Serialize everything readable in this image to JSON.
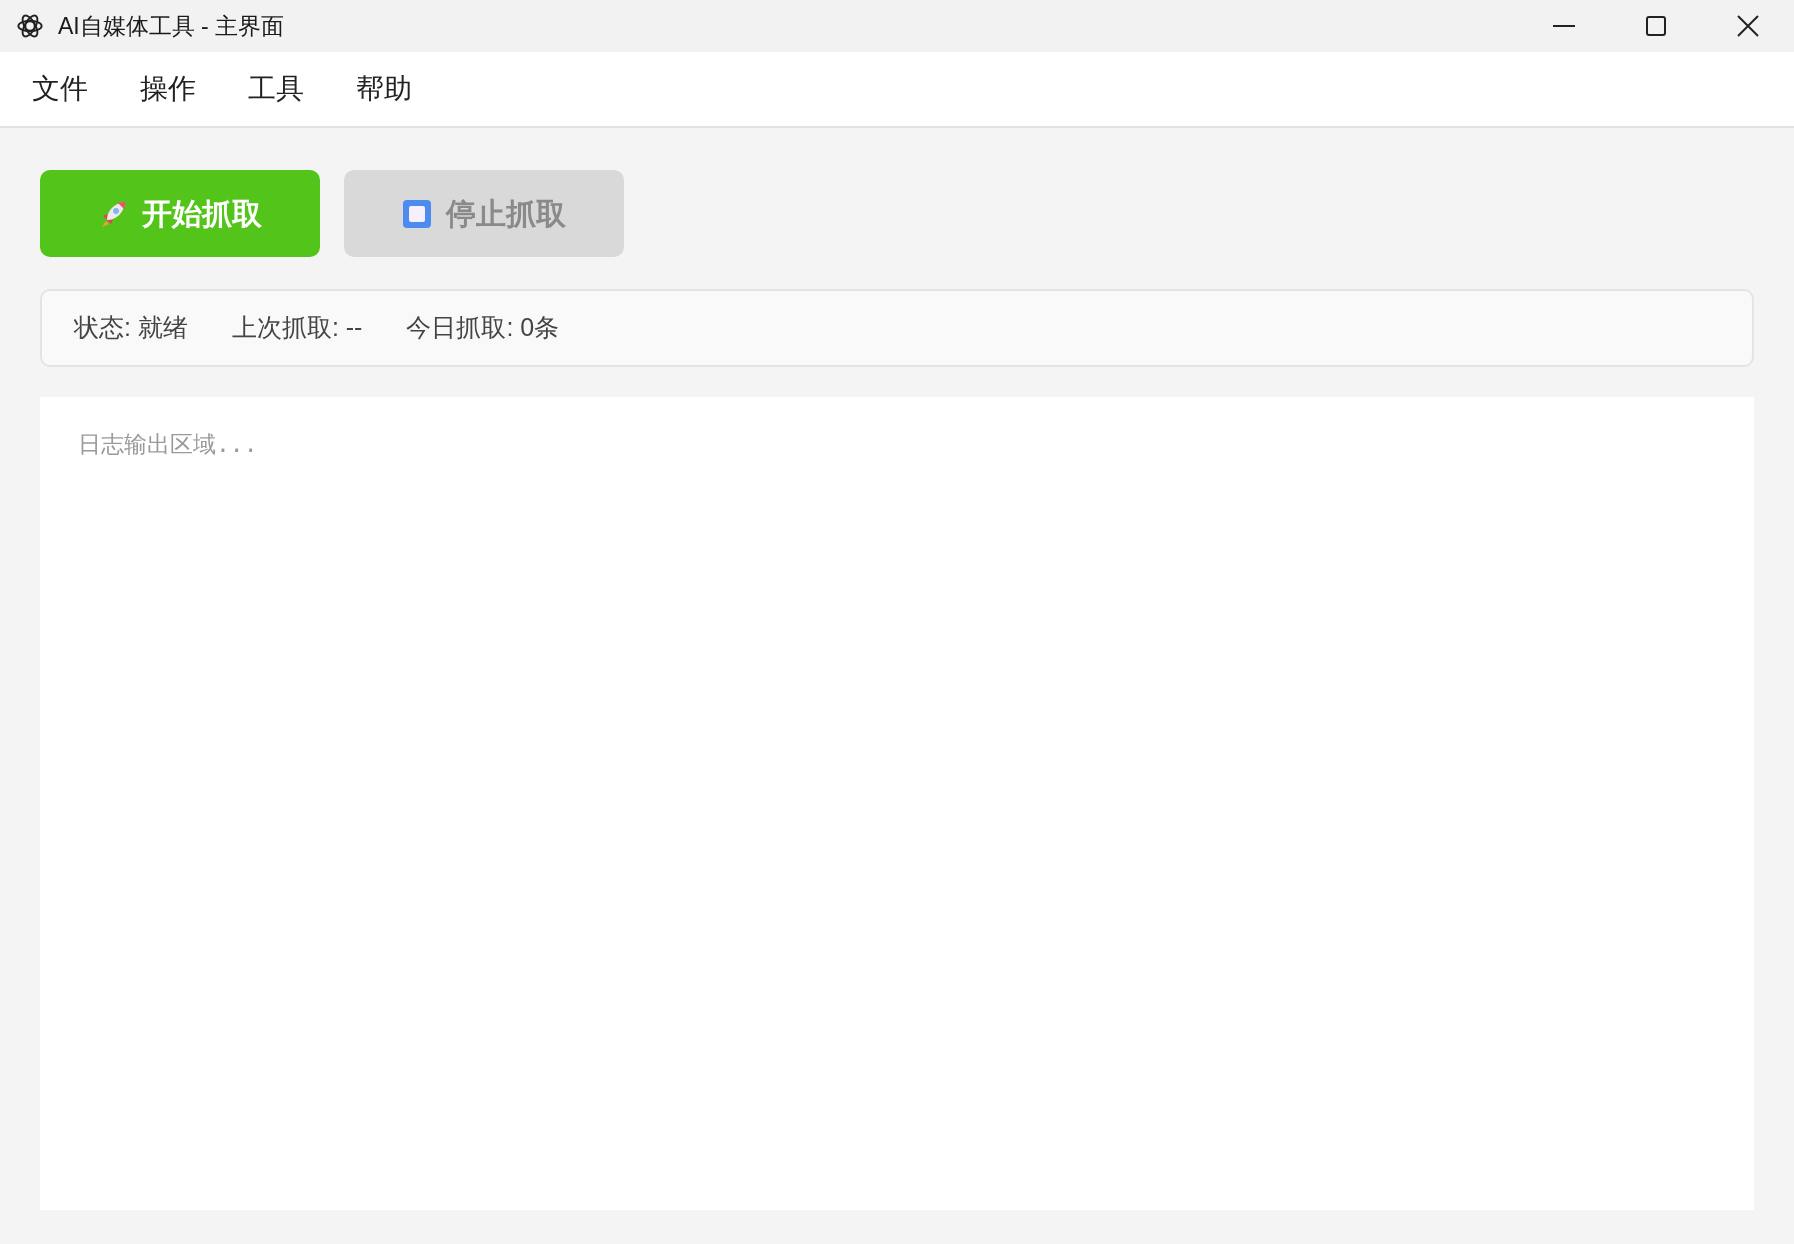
{
  "window": {
    "title": "AI自媒体工具 - 主界面"
  },
  "menu": [
    {
      "label": "文件"
    },
    {
      "label": "操作"
    },
    {
      "label": "工具"
    },
    {
      "label": "帮助"
    }
  ],
  "buttons": [
    {
      "kind": "start",
      "label": "开始抓取",
      "disabled": false
    },
    {
      "kind": "stop",
      "label": "停止抓取",
      "disabled": true
    }
  ],
  "status": [
    "状态: 就绪",
    "上次抓取: --",
    "今日抓取: 0条"
  ],
  "log": {
    "placeholder": "日志输出区域..."
  }
}
